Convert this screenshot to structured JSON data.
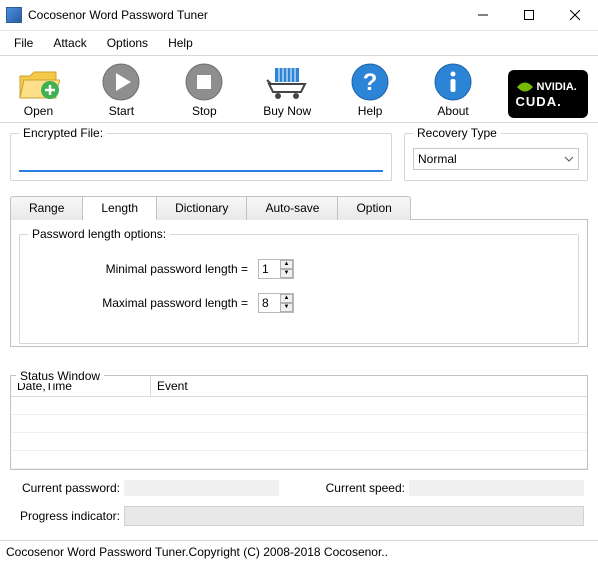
{
  "window": {
    "title": "Cocosenor Word Password Tuner"
  },
  "menus": {
    "file": "File",
    "attack": "Attack",
    "options": "Options",
    "help": "Help"
  },
  "toolbar": {
    "open": "Open",
    "start": "Start",
    "stop": "Stop",
    "buy": "Buy Now",
    "help": "Help",
    "about": "About",
    "cuda_brand": "NVIDIA.",
    "cuda_text": "CUDA."
  },
  "panels": {
    "encrypted_label": "Encrypted File:",
    "encrypted_value": "",
    "recovery_label": "Recovery Type",
    "recovery_value": "Normal"
  },
  "tabs": {
    "range": "Range",
    "length": "Length",
    "dictionary": "Dictionary",
    "autosave": "Auto-save",
    "option": "Option"
  },
  "lengthTab": {
    "heading": "Password length options:",
    "min_label": "Minimal password length  =",
    "min_value": "1",
    "max_label": "Maximal password length  =",
    "max_value": "8"
  },
  "status": {
    "legend": "Status Window",
    "col_date": "Date,Time",
    "col_event": "Event"
  },
  "bottom": {
    "cur_pw_label": "Current password:",
    "cur_speed_label": "Current speed:",
    "progress_label": "Progress indicator:"
  },
  "footer": "Cocosenor Word Password Tuner.Copyright (C) 2008-2018 Cocosenor.."
}
